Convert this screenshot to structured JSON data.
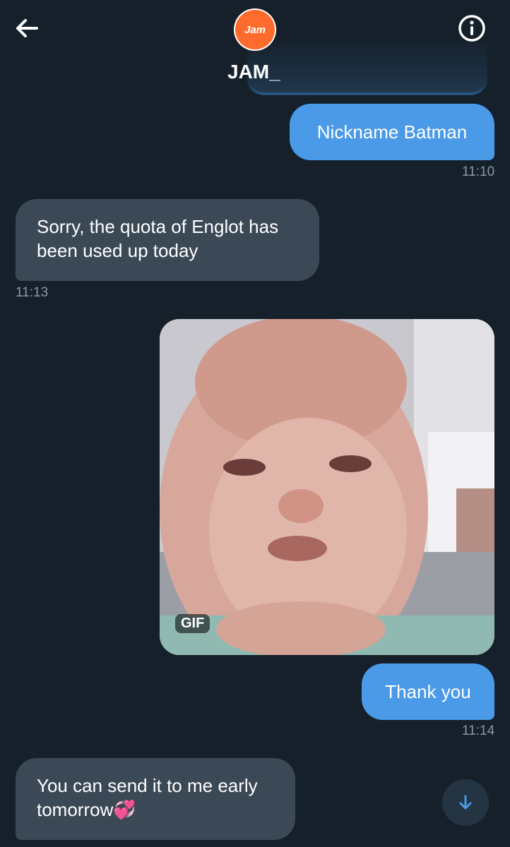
{
  "header": {
    "avatar_text": "Jam",
    "contact_name": "JAM_"
  },
  "messages": [
    {
      "text": "Nickname Batman",
      "time": "11:10"
    },
    {
      "text": "Sorry, the quota of Englot has been used up today",
      "time": "11:13"
    },
    {
      "gif_label": "GIF"
    },
    {
      "text": "Thank you",
      "time": "11:14"
    },
    {
      "text": "You can send it to me early tomorrow",
      "emoji": "💞"
    }
  ],
  "colors": {
    "background": "#15202b",
    "outgoing_bubble": "#4a9ae8",
    "incoming_bubble": "#3b4856",
    "timestamp": "#8b98a5",
    "accent": "#4a9ae8"
  },
  "icons": {
    "back": "arrow-left-icon",
    "info": "info-icon",
    "scroll_down": "arrow-down-icon"
  }
}
